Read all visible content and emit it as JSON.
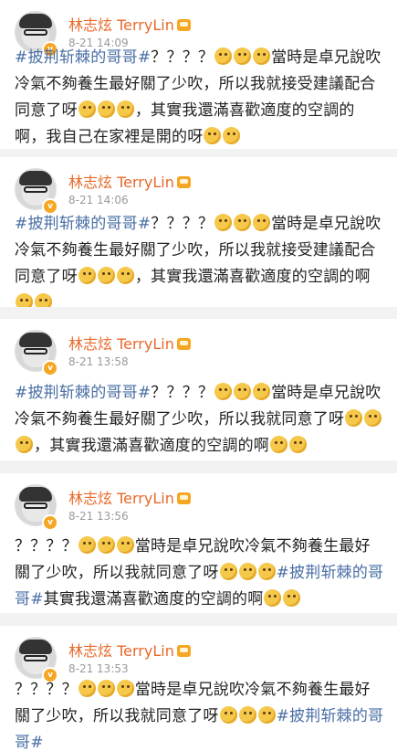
{
  "colors": {
    "name": "#e8692a",
    "hashtag": "#4a6fa5",
    "time": "#9a9a9a",
    "badge": "#f5a623"
  },
  "icons": {
    "avatar": "avatar-icon",
    "verified": "verified-badge-icon",
    "vip": "crown-icon",
    "emoji": "thinking-face-emoji-icon"
  },
  "posts": [
    {
      "author": "林志炫 TerryLin",
      "time": "8-21 14:09",
      "segments": [
        {
          "t": "tag",
          "v": "#披荆斩棘的哥哥#"
        },
        {
          "t": "txt",
          "v": "？？？？"
        },
        {
          "t": "emo"
        },
        {
          "t": "emo"
        },
        {
          "t": "emo"
        },
        {
          "t": "txt",
          "v": "當時是卓兄說吹冷氣不夠養生最好關了少吹，所以我就接受建議配合同意了呀"
        },
        {
          "t": "emo"
        },
        {
          "t": "emo"
        },
        {
          "t": "emo"
        },
        {
          "t": "txt",
          "v": "，其實我還滿喜歡適度的空調的啊，我自己在家裡是開的呀"
        },
        {
          "t": "emo"
        },
        {
          "t": "emo"
        }
      ]
    },
    {
      "author": "林志炫 TerryLin",
      "time": "8-21 14:06",
      "segments": [
        {
          "t": "tag",
          "v": "#披荆斩棘的哥哥#"
        },
        {
          "t": "txt",
          "v": "？？？？"
        },
        {
          "t": "emo"
        },
        {
          "t": "emo"
        },
        {
          "t": "emo"
        },
        {
          "t": "txt",
          "v": "當時是卓兄說吹冷氣不夠養生最好關了少吹，所以我就接受建議配合同意了呀"
        },
        {
          "t": "emo"
        },
        {
          "t": "emo"
        },
        {
          "t": "emo"
        },
        {
          "t": "txt",
          "v": "，其實我還滿喜歡適度的空調的啊"
        },
        {
          "t": "emo"
        },
        {
          "t": "emo"
        }
      ]
    },
    {
      "author": "林志炫 TerryLin",
      "time": "8-21 13:58",
      "segments": [
        {
          "t": "tag",
          "v": "#披荆斩棘的哥哥#"
        },
        {
          "t": "txt",
          "v": "？？？？"
        },
        {
          "t": "emo"
        },
        {
          "t": "emo"
        },
        {
          "t": "emo"
        },
        {
          "t": "txt",
          "v": "當時是卓兄說吹冷氣不夠養生最好關了少吹，所以我就同意了呀"
        },
        {
          "t": "emo"
        },
        {
          "t": "emo"
        },
        {
          "t": "emo"
        },
        {
          "t": "txt",
          "v": "，其實我還滿喜歡適度的空調的啊"
        },
        {
          "t": "emo"
        },
        {
          "t": "emo"
        }
      ]
    },
    {
      "author": "林志炫 TerryLin",
      "time": "8-21 13:56",
      "segments": [
        {
          "t": "txt",
          "v": "？？？？"
        },
        {
          "t": "emo"
        },
        {
          "t": "emo"
        },
        {
          "t": "emo"
        },
        {
          "t": "txt",
          "v": "當時是卓兄說吹冷氣不夠養生最好關了少吹，所以我就同意了呀"
        },
        {
          "t": "emo"
        },
        {
          "t": "emo"
        },
        {
          "t": "emo"
        },
        {
          "t": "tag",
          "v": "#披荆斩棘的哥哥#"
        },
        {
          "t": "txt",
          "v": "其實我還滿喜歡適度的空調的啊"
        },
        {
          "t": "emo"
        },
        {
          "t": "emo"
        }
      ]
    },
    {
      "author": "林志炫 TerryLin",
      "time": "8-21 13:53",
      "segments": [
        {
          "t": "txt",
          "v": "？？？？"
        },
        {
          "t": "emo"
        },
        {
          "t": "emo"
        },
        {
          "t": "emo"
        },
        {
          "t": "txt",
          "v": "當時是卓兄說吹冷氣不夠養生最好關了少吹，所以我就同意了呀"
        },
        {
          "t": "emo"
        },
        {
          "t": "emo"
        },
        {
          "t": "emo"
        },
        {
          "t": "tag",
          "v": "#披荆斩棘的哥哥#"
        }
      ]
    }
  ]
}
